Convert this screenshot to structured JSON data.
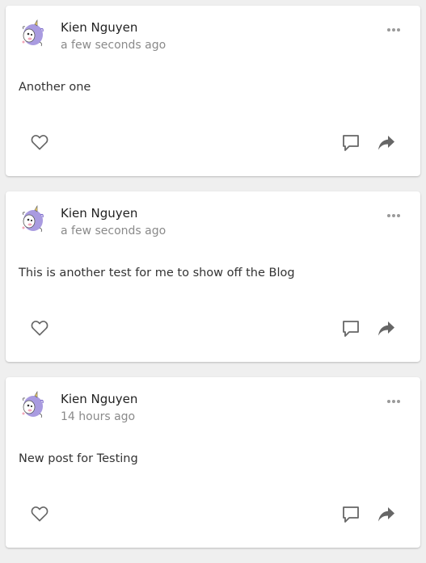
{
  "colors": {
    "page_background": "#efefef",
    "card_background": "#ffffff",
    "icon_gray": "#666666",
    "timestamp_gray": "#8a8a8a"
  },
  "posts": [
    {
      "author": "Kien Nguyen",
      "time": "a few seconds ago",
      "body": "Another one",
      "icons": {
        "avatar": "unicorn-avatar",
        "more": "more-horizontal-icon",
        "like": "heart-icon",
        "comment": "comment-icon",
        "share": "share-arrow-icon"
      }
    },
    {
      "author": "Kien Nguyen",
      "time": "a few seconds ago",
      "body": "This is another test for me to show off the Blog",
      "icons": {
        "avatar": "unicorn-avatar",
        "more": "more-horizontal-icon",
        "like": "heart-icon",
        "comment": "comment-icon",
        "share": "share-arrow-icon"
      }
    },
    {
      "author": "Kien Nguyen",
      "time": "14 hours ago",
      "body": "New post for Testing",
      "icons": {
        "avatar": "unicorn-avatar",
        "more": "more-horizontal-icon",
        "like": "heart-icon",
        "comment": "comment-icon",
        "share": "share-arrow-icon"
      }
    }
  ]
}
